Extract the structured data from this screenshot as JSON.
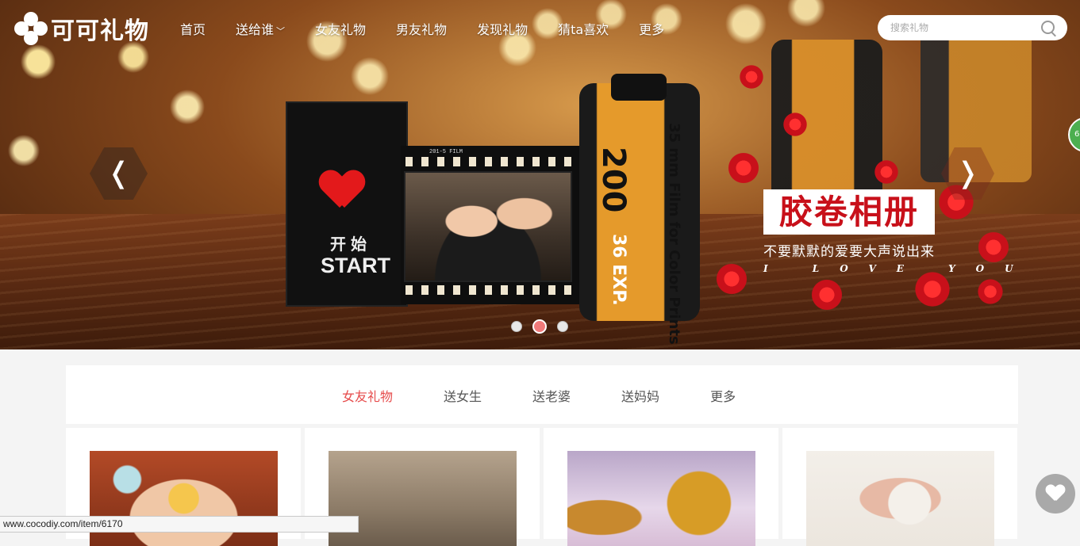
{
  "brand": {
    "name": "可可礼物"
  },
  "nav": {
    "items": [
      {
        "label": "首页"
      },
      {
        "label": "送给谁",
        "has_dropdown": true
      },
      {
        "label": "女友礼物"
      },
      {
        "label": "男友礼物"
      },
      {
        "label": "发现礼物"
      },
      {
        "label": "猜ta喜欢"
      },
      {
        "label": "更多"
      }
    ]
  },
  "search": {
    "placeholder": "搜索礼物",
    "icon": "search-icon"
  },
  "banner": {
    "title": "胶卷相册",
    "subtitle": "不要默默的爱要大声说出来",
    "tagline": "I LOVE YOU",
    "prev_label": "❬",
    "next_label": "❭",
    "film_text_cn": "开始",
    "film_text_en": "START",
    "film_strip_label": "201-5 FILM",
    "canister_speed": "200",
    "canister_exp": "36 EXP.",
    "canister_text": "35 mm Film for Color Prints",
    "dots": 3,
    "active_dot": 2,
    "side_badge": "6"
  },
  "category_tabs": {
    "items": [
      {
        "label": "女友礼物",
        "active": true
      },
      {
        "label": "送女生"
      },
      {
        "label": "送老婆"
      },
      {
        "label": "送妈妈"
      },
      {
        "label": "更多"
      }
    ]
  },
  "products": [
    {
      "name": "product-card-1"
    },
    {
      "name": "product-card-2"
    },
    {
      "name": "product-card-3"
    },
    {
      "name": "product-card-4"
    }
  ],
  "status_bar": {
    "url": "www.cocodiy.com/item/6170"
  },
  "colors": {
    "accent": "#e64b4b",
    "banner_title": "#c8101a"
  }
}
